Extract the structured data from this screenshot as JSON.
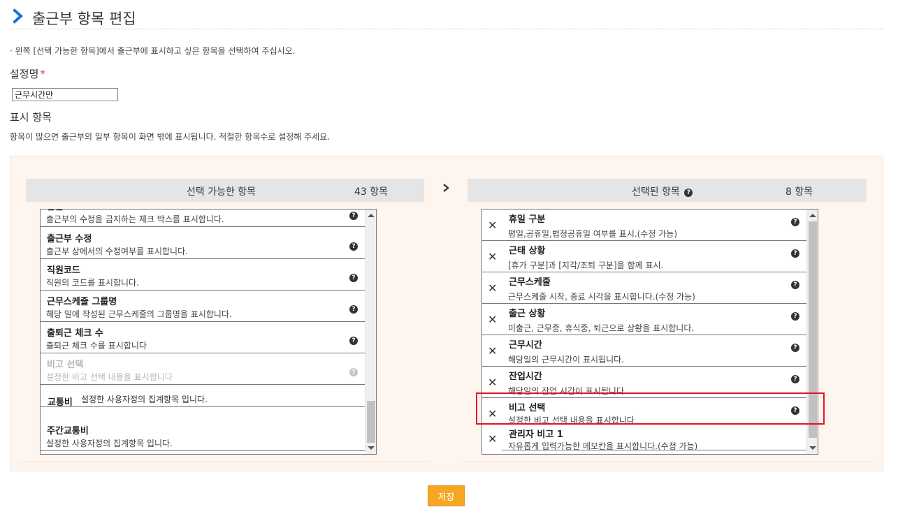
{
  "header": {
    "title": "출근부 항목 편집"
  },
  "intro": "· 왼쪽 [선택 가능한 항목]에서 출근부에 표시하고 싶은 항목을 선택하여 주십시오.",
  "setting_name": {
    "label": "설정명",
    "required_mark": "*",
    "value": "근무시간만"
  },
  "display_items": {
    "label": "표시 항목",
    "note": "항목이 많으면 출근부의 일부 항목이 화면 밖에 표시됩니다. 적절한 항목수로 설정해 주세요."
  },
  "available": {
    "title": "선택 가능한 항목",
    "count": "43 항목",
    "items": [
      {
        "title": "잠금",
        "desc": "출근부의 수정을 금지하는 체크 박스를 표시합니다.",
        "disabled": false
      },
      {
        "title": "출근부 수정",
        "desc": "출근부 상에서의 수정여부를 표시합니다.",
        "disabled": false
      },
      {
        "title": "직원코드",
        "desc": "직원의 코드를 표시합니다.",
        "disabled": false
      },
      {
        "title": "근무스케줄 그룹명",
        "desc": "해당 일에 작성된 근무스케줄의 그룹명을 표시합니다.",
        "disabled": false
      },
      {
        "title": "출퇴근 체크 수",
        "desc": "출퇴근 체크 수를 표시합니다",
        "disabled": false
      },
      {
        "title": "비고 선택",
        "desc": "설정한 비고 선택 내용을 표시합니다",
        "disabled": true
      },
      {
        "title": "교통비",
        "desc": "설정한 사용자정의 집계항목 입니다.",
        "disabled": false
      },
      {
        "title": "주간교통비",
        "desc": "설정한 사용자정의 집계항목 입니다.",
        "disabled": false
      }
    ]
  },
  "selected": {
    "title": "선택된 항목",
    "count": "8 항목",
    "items": [
      {
        "title": "휴일 구분",
        "desc": "평일,공휴일,법정공휴일 여부를 표시.(수정 가능)"
      },
      {
        "title": "근태 상황",
        "desc": "[휴가 구분]과 [지각/조퇴 구분]을 함께 표시."
      },
      {
        "title": "근무스케줄",
        "desc": "근무스케줄 시작, 종료 시각을 표시합니다.(수정 가능)"
      },
      {
        "title": "출근 상황",
        "desc": "미출근, 근무중, 휴식중, 퇴근으로 상황을 표시합니다."
      },
      {
        "title": "근무시간",
        "desc": "해당일의 근무시간이 표시됩니다."
      },
      {
        "title": "잔업시간",
        "desc": "해당일의 잔업 시간이 표시됩니다."
      },
      {
        "title": "비고 선택",
        "desc": "설정한 비고 선택 내용을 표시합니다"
      },
      {
        "title": "관리자 비고 1",
        "desc": "자유롭게 입력가능한 메모칸을 표시합니다.(수정 가능)"
      }
    ]
  },
  "actions": {
    "save_label": "저장"
  },
  "icons": {
    "title": "chevron-right-icon",
    "transfer": "chevron-right-icon",
    "help": "question-circle-icon",
    "remove": "close-icon"
  },
  "colors": {
    "accent_blue": "#1a73d9",
    "save_orange": "#f7a623",
    "highlight_red": "#e8121c",
    "panel_bg": "#fff5ef"
  }
}
